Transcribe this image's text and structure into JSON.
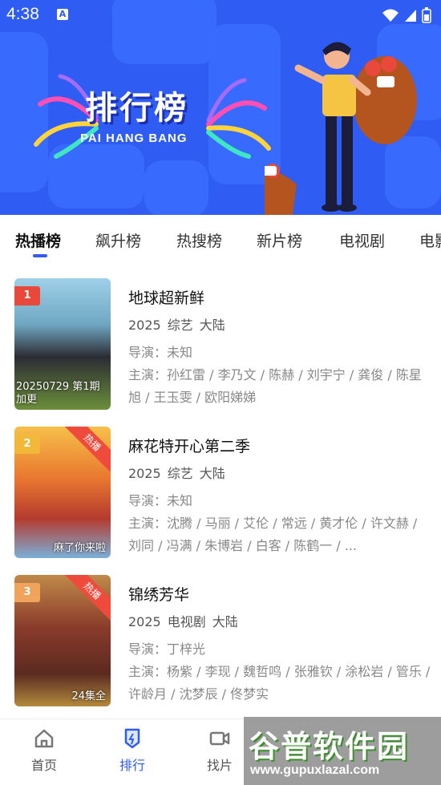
{
  "status_bar": {
    "time": "4:38",
    "notif_letter": "A"
  },
  "banner": {
    "title": "排行榜",
    "subtitle": "PAI HANG BANG"
  },
  "tabs": [
    {
      "label": "热播榜",
      "active": true
    },
    {
      "label": "飙升榜"
    },
    {
      "label": "热搜榜"
    },
    {
      "label": "新片榜"
    },
    {
      "label": "电视剧"
    },
    {
      "label": "电影"
    }
  ],
  "list": [
    {
      "rank": "1",
      "rank_color": "#e8493a",
      "hot_badge": "",
      "poster_caption": "20250729 第1期加更",
      "title": "地球超新鲜",
      "year": "2025",
      "genre": "综艺",
      "region": "大陆",
      "director": "导演：未知",
      "cast": "主演：孙红雷 / 李乃文 / 陈赫 / 刘宇宁 / 龚俊 / 陈星旭 / 王玉雯 / 欧阳娣娣"
    },
    {
      "rank": "2",
      "rank_color": "#f2b83a",
      "hot_badge": "热播",
      "poster_caption": "麻了你来啦",
      "title": "麻花特开心第二季",
      "year": "2025",
      "genre": "综艺",
      "region": "大陆",
      "director": "导演：未知",
      "cast": "主演：沈腾 / 马丽 / 艾伦 / 常远 / 黄才伦 / 许文赫 / 刘同 / 冯满 / 朱博岩 / 白客 / 陈鹤一 / ..."
    },
    {
      "rank": "3",
      "rank_color": "#f0a35a",
      "hot_badge": "热播",
      "poster_caption": "24集全",
      "title": "锦绣芳华",
      "year": "2025",
      "genre": "电视剧",
      "region": "大陆",
      "director": "导演：丁梓光",
      "cast": "主演：杨紫 / 李现 / 魏哲鸣 / 张雅钦 / 涂松岩 / 管乐 / 许龄月 / 沈梦辰 / 佟梦实"
    }
  ],
  "nav": [
    {
      "label": "首页",
      "icon": "home-icon"
    },
    {
      "label": "排行",
      "icon": "ranking-icon",
      "active": true
    },
    {
      "label": "找片",
      "icon": "video-icon"
    }
  ],
  "watermark": {
    "text": "谷普软件园",
    "url": "www.gupuxlazal.com"
  },
  "colors": {
    "accent": "#2f5cf2",
    "banner_bg": "#2f5cf2",
    "hot": "#ef4b3d"
  }
}
